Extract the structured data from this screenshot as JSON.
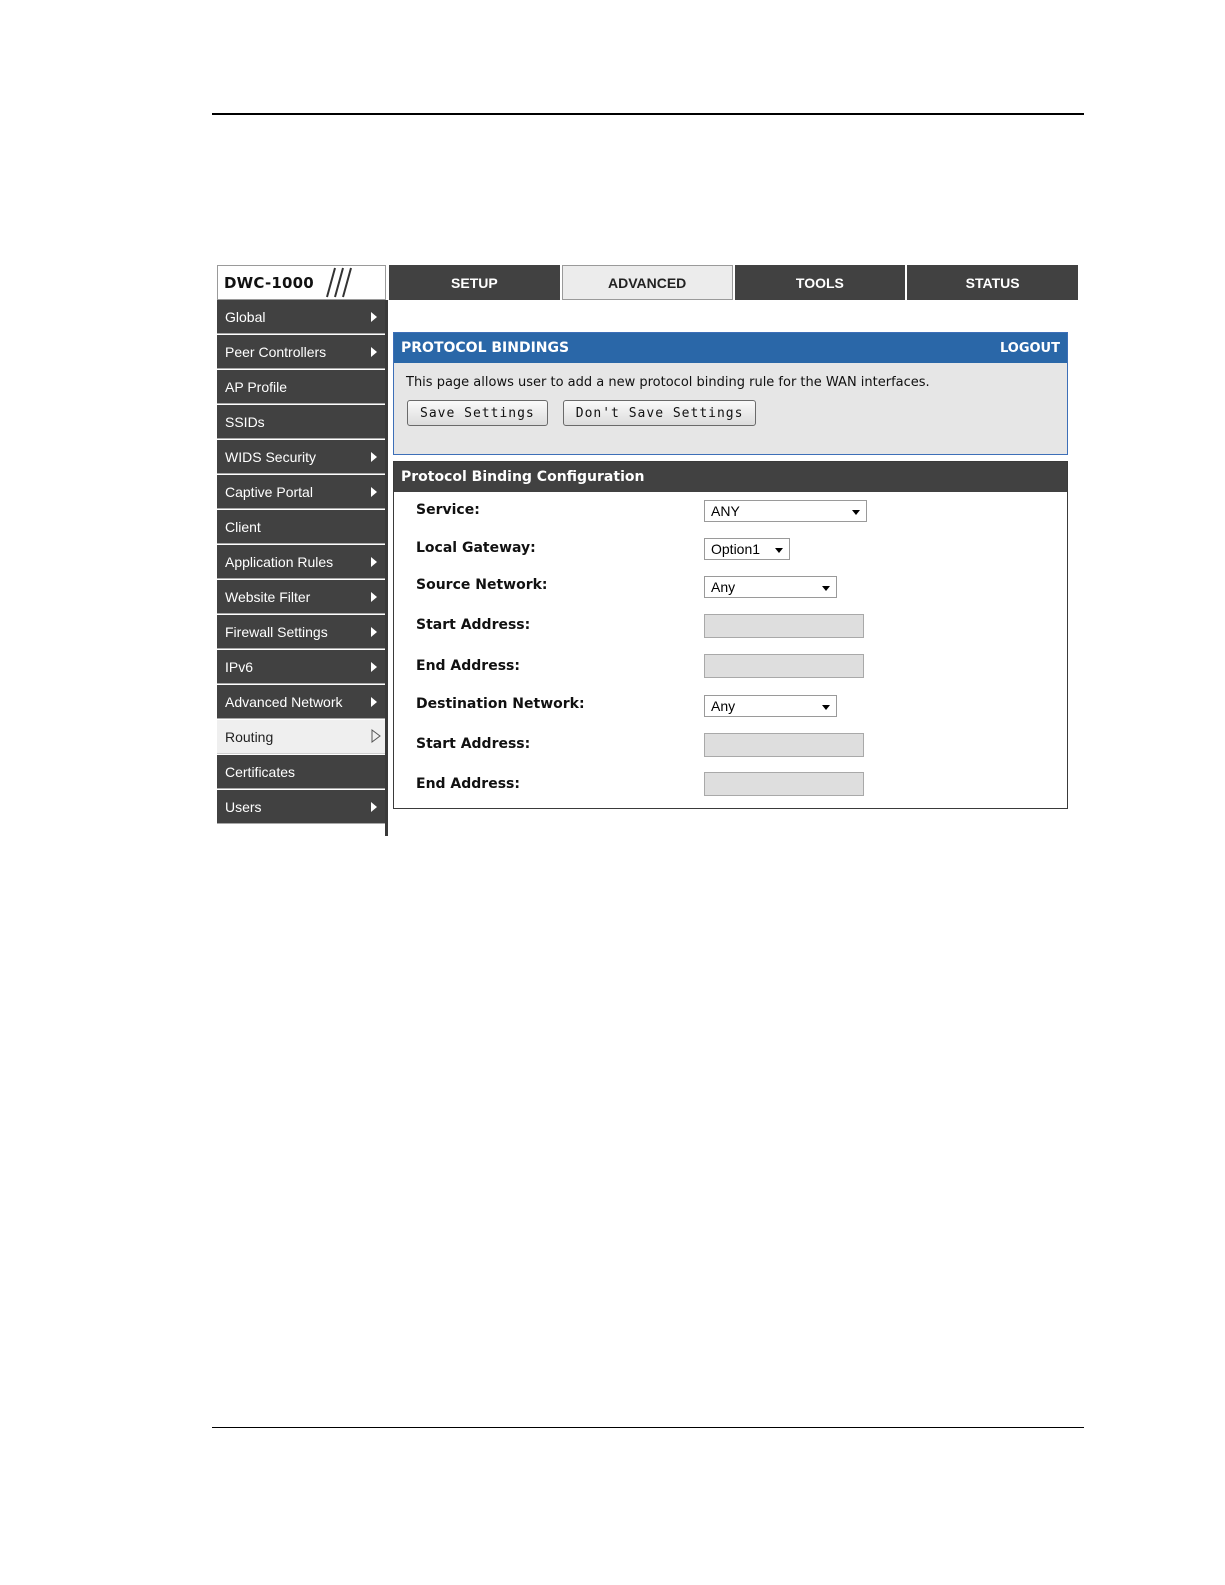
{
  "app": {
    "logo": "DWC-1000"
  },
  "tabs": [
    {
      "label": "SETUP",
      "active": false
    },
    {
      "label": "ADVANCED",
      "active": true
    },
    {
      "label": "TOOLS",
      "active": false
    },
    {
      "label": "STATUS",
      "active": false
    }
  ],
  "sidebar": {
    "items": [
      {
        "label": "Global",
        "icon": "chevron-right-icon"
      },
      {
        "label": "Peer Controllers",
        "icon": "chevron-right-icon"
      },
      {
        "label": "AP Profile"
      },
      {
        "label": "SSIDs"
      },
      {
        "label": "WIDS Security",
        "icon": "chevron-right-icon"
      },
      {
        "label": "Captive Portal",
        "icon": "chevron-right-icon"
      },
      {
        "label": "Client"
      },
      {
        "label": "Application Rules",
        "icon": "chevron-right-icon"
      },
      {
        "label": "Website Filter",
        "icon": "chevron-right-icon"
      },
      {
        "label": "Firewall Settings",
        "icon": "chevron-right-icon"
      },
      {
        "label": "IPv6",
        "icon": "chevron-right-icon"
      },
      {
        "label": "Advanced Network",
        "icon": "chevron-right-icon"
      },
      {
        "label": "Routing",
        "icon": "chevron-right-outline-icon",
        "selected": true
      },
      {
        "label": "Certificates"
      },
      {
        "label": "Users",
        "icon": "chevron-right-icon"
      }
    ]
  },
  "bindings": {
    "title": "PROTOCOL BINDINGS",
    "logout": "LOGOUT",
    "description": "This page allows user to add a new protocol binding rule for the WAN interfaces.",
    "save_label": "Save Settings",
    "dont_save_label": "Don't Save Settings"
  },
  "config": {
    "title": "Protocol Binding Configuration",
    "service_label": "Service:",
    "service_value": "ANY",
    "gateway_label": "Local Gateway:",
    "gateway_value": "Option1",
    "source_label": "Source Network:",
    "source_value": "Any",
    "src_start_label": "Start Address:",
    "src_end_label": "End Address:",
    "dest_label": "Destination Network:",
    "dest_value": "Any",
    "dst_start_label": "Start Address:",
    "dst_end_label": "End Address:"
  },
  "colors": {
    "nav_dark": "#414141",
    "panel_blue": "#2a67a8",
    "panel_bg": "#e6e6e6"
  }
}
